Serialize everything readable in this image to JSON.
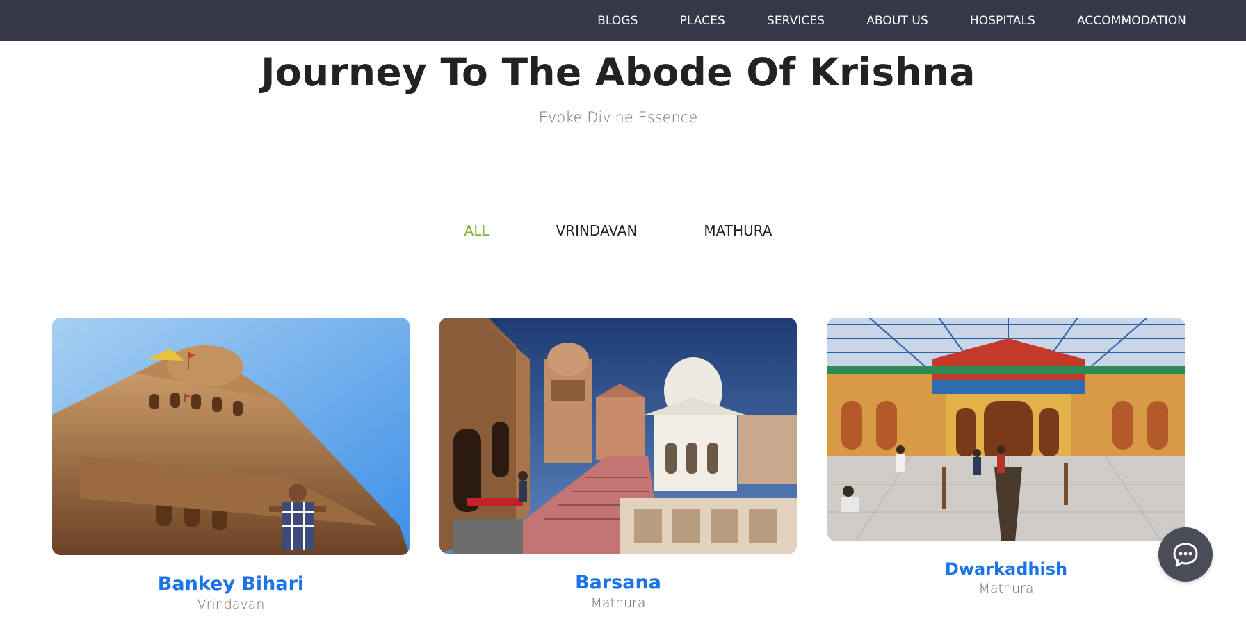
{
  "nav": {
    "items": [
      "BLOGS",
      "PLACES",
      "SERVICES",
      "ABOUT US",
      "HOSPITALS",
      "ACCOMMODATION"
    ]
  },
  "hero": {
    "title": "Journey To The Abode Of Krishna",
    "subtitle": "Evoke Divine Essence"
  },
  "filters": {
    "items": [
      "ALL",
      "VRINDAVAN",
      "MATHURA"
    ],
    "active": "ALL"
  },
  "cards": [
    {
      "name": "Bankey Bihari",
      "city": "Vrindavan"
    },
    {
      "name": "Barsana",
      "city": "Mathura"
    },
    {
      "name": "Dwarkadhish",
      "city": "Mathura"
    }
  ],
  "chat": {
    "icon": "chat-bubble-icon"
  },
  "colors": {
    "topbar": "#353848",
    "accent_green": "#7cb13a",
    "link_blue": "#1a73e8",
    "chat_bg": "#4a4d58"
  }
}
